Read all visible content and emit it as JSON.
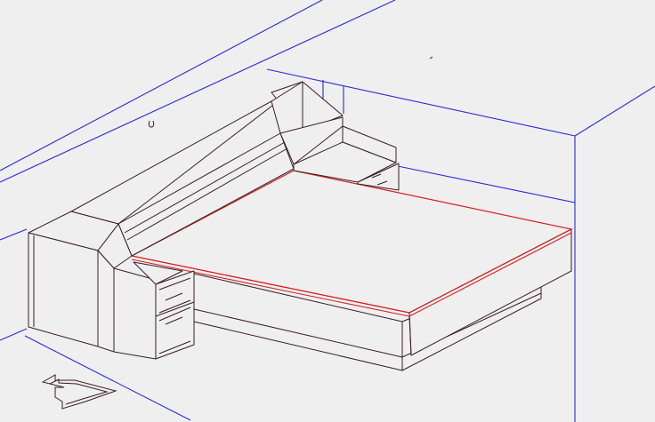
{
  "scene": {
    "kind": "3d-wireframe-bedroom",
    "colors": {
      "background": "#efefef",
      "room_lines": "#2a2ad8",
      "furniture_lines": "#3a1e28",
      "mattress_outline": "#d42020"
    },
    "objects": [
      "room-walls",
      "headboard-unit",
      "right-nightstand",
      "left-nightstand",
      "bed-base",
      "mattress",
      "wall-hook",
      "navigation-arrow"
    ]
  }
}
